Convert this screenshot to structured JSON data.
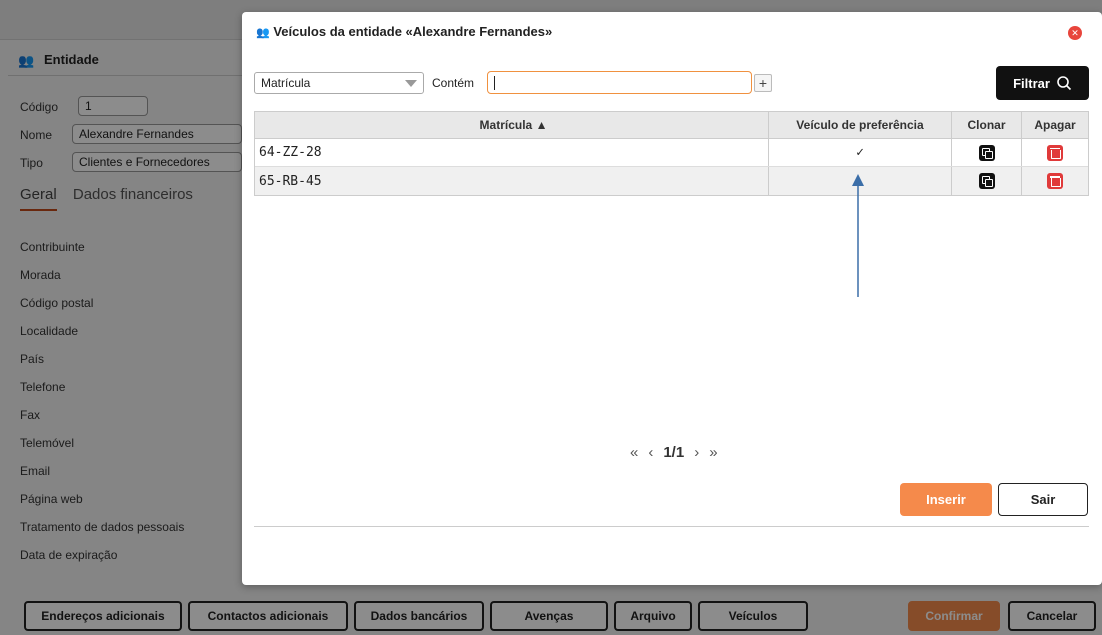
{
  "background": {
    "panel_title": "Entidade",
    "fields": {
      "codigo_label": "Código",
      "codigo_value": "1",
      "nome_label": "Nome",
      "nome_value": "Alexandre Fernandes",
      "tipo_label": "Tipo",
      "tipo_value": "Clientes e Fornecedores"
    },
    "tabs": [
      "Geral",
      "Dados financeiros"
    ],
    "labels": [
      "Contribuinte",
      "Morada",
      "Código postal",
      "Localidade",
      "País",
      "Telefone",
      "Fax",
      "Telemóvel",
      "Email",
      "Página web",
      "Tratamento de dados pessoais",
      "Data de expiração"
    ],
    "bottom_buttons": [
      "Endereços adicionais",
      "Contactos adicionais",
      "Dados bancários",
      "Avenças",
      "Arquivo",
      "Veículos",
      "Confirmar",
      "Cancelar"
    ]
  },
  "modal": {
    "title": "Veículos da entidade «Alexandre Fernandes»",
    "filter": {
      "field_select": "Matrícula",
      "operator_label": "Contém",
      "search_value": "",
      "add_label": "+",
      "filter_button": "Filtrar"
    },
    "table": {
      "columns": [
        "Matrícula ▲",
        "Veículo de preferência",
        "Clonar",
        "Apagar"
      ],
      "rows": [
        {
          "matricula": "64-ZZ-28",
          "preferencia": "✓"
        },
        {
          "matricula": "65-RB-45",
          "preferencia": ""
        }
      ]
    },
    "pagination": {
      "first": "«",
      "prev": "‹",
      "page": "1/1",
      "next": "›",
      "last": "»"
    },
    "buttons": {
      "insert": "Inserir",
      "exit": "Sair"
    }
  },
  "colors": {
    "accent": "#f58a4b",
    "danger": "#e03a3a",
    "arrow": "#3b6ea8"
  }
}
